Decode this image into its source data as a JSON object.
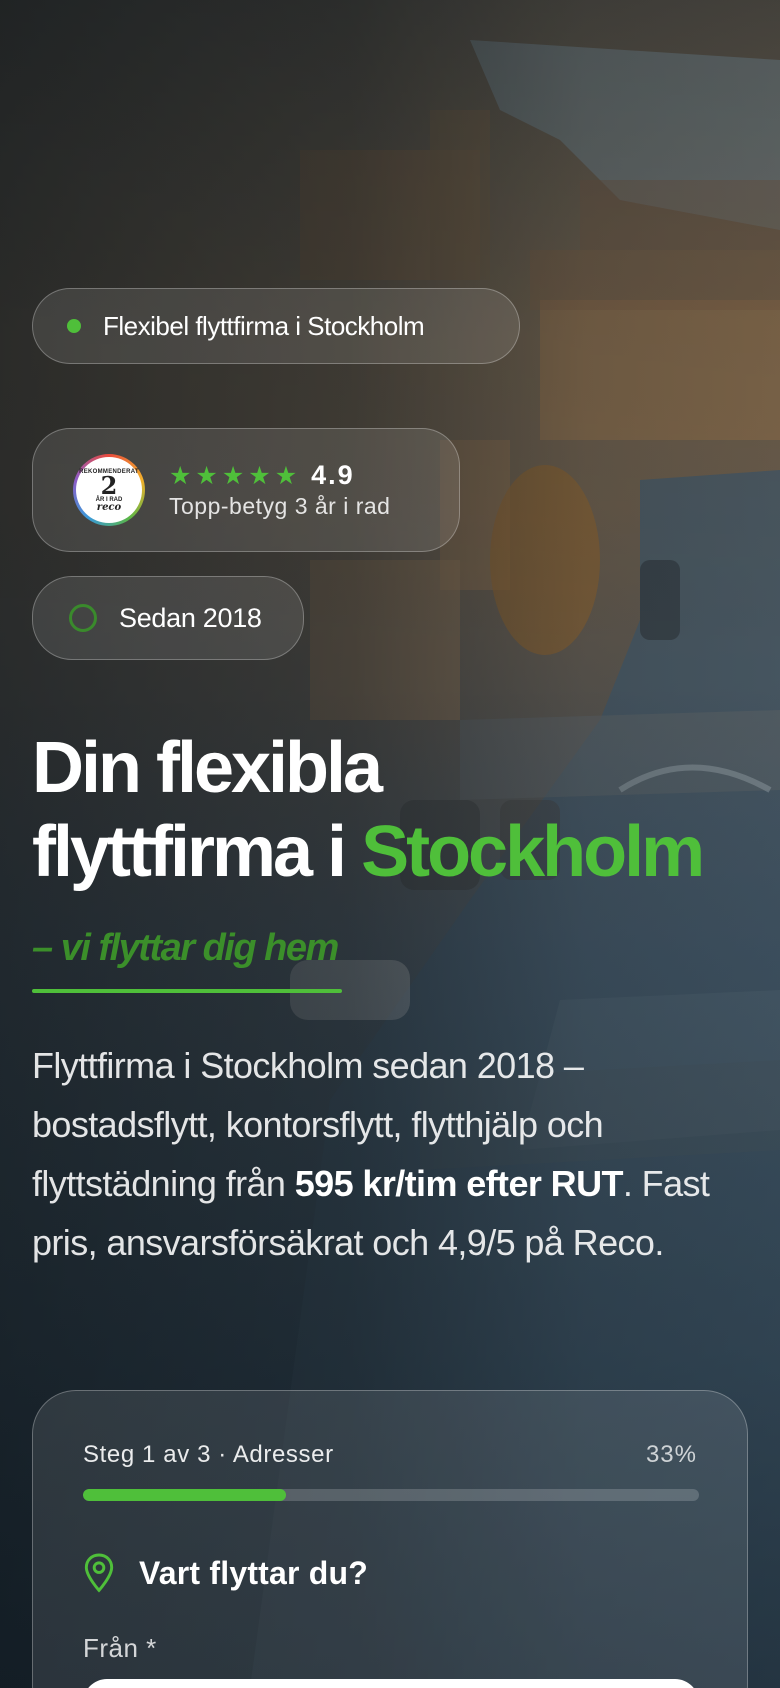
{
  "hero": {
    "location_pill": "Flexibel flyttfirma i Stockholm",
    "rating": {
      "badge_top": "REKOMMENDERAT",
      "badge_number": "2",
      "badge_years": "ÅR I RAD",
      "badge_brand": "reco",
      "stars": 5,
      "score": "4.9",
      "subtitle": "Topp-betyg 3 år i rad"
    },
    "since_pill": "Sedan 2018",
    "title_line1": "Din flexibla",
    "title_line2_prefix": "flyttfirma i ",
    "title_line2_accent": "Stockholm",
    "tagline": "– vi flyttar dig hem",
    "intro_part1": "Flyttfirma i Stockholm sedan 2018 – bostadsflytt, kontorsflytt, flytthjälp och flyttstädning från ",
    "intro_bold": "595 kr/tim efter RUT",
    "intro_part2": ". Fast pris, ansvarsförsäkrat och 4,9/5 på Reco."
  },
  "form": {
    "step_label": "Steg 1 av 3 · Adresser",
    "progress_text": "33%",
    "progress_fraction": 0.33,
    "question": "Vart flyttar du?",
    "from_label": "Från *",
    "from_value": ""
  },
  "colors": {
    "accent": "#4fbf3a",
    "tagline": "#3b8f2a"
  },
  "icons": {
    "location_dot": "status-dot-icon",
    "star": "star-icon",
    "since": "ring-icon",
    "question": "map-pin-icon"
  }
}
